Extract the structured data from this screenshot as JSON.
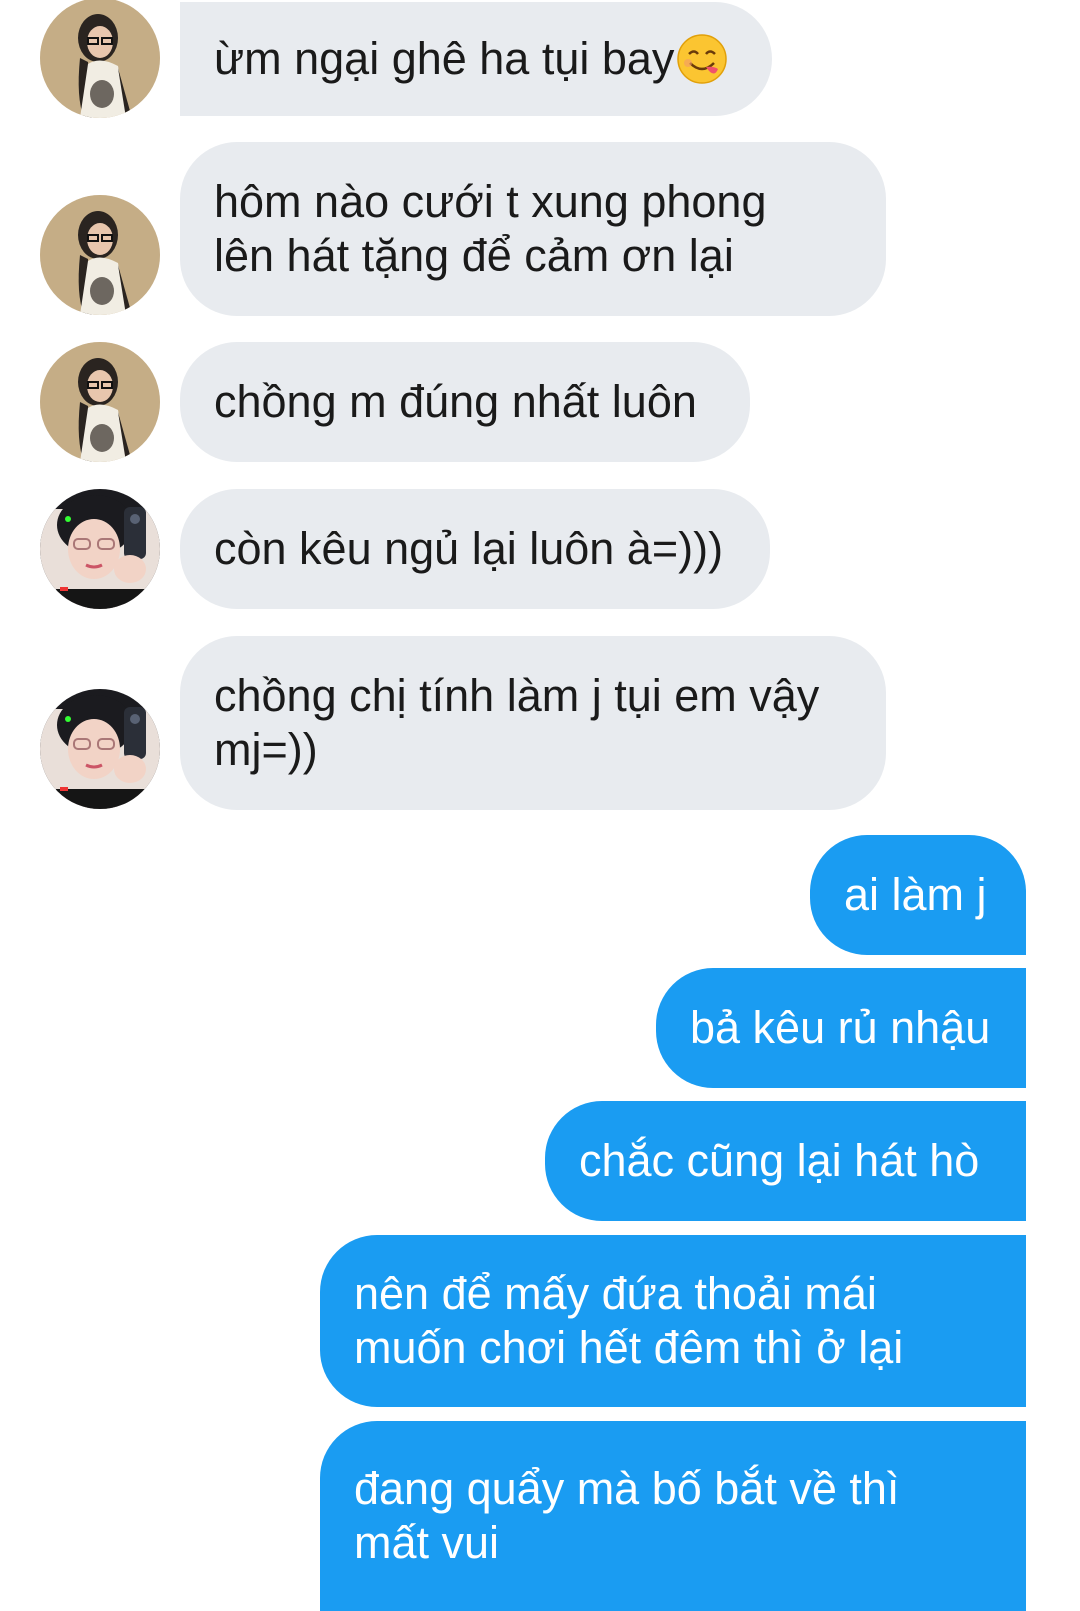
{
  "conversation": {
    "incoming": [
      {
        "text": "ừm ngại ghê ha tụi bay",
        "emoji": "face-savoring-food-emoji",
        "avatar": "avatar-girl-glasses-icon"
      },
      {
        "text": "hôm nào cưới t xung phong\nlên hát tặng để cảm ơn lại",
        "avatar": "avatar-girl-glasses-icon"
      },
      {
        "text": "chồng m đúng nhất luôn",
        "avatar": "avatar-girl-glasses-icon"
      },
      {
        "text": "còn kêu ngủ lại luôn à=)))",
        "avatar": "avatar-girl-phone-icon"
      },
      {
        "text": "chồng chị tính làm j tụi em vậy\nmj=))",
        "avatar": "avatar-girl-phone-icon"
      }
    ],
    "outgoing": [
      {
        "text": "ai làm j"
      },
      {
        "text": "bả kêu rủ nhậu"
      },
      {
        "text": "chắc cũng lại hát hò"
      },
      {
        "text": "nên để mấy đứa thoải mái\nmuốn chơi hết đêm thì ở lại"
      },
      {
        "text": "đang quẩy mà bố bắt về thì\nmất vui"
      }
    ]
  },
  "colors": {
    "incoming_bubble": "#e8ebef",
    "outgoing_bubble": "#1a9cf2",
    "background": "#ffffff"
  }
}
